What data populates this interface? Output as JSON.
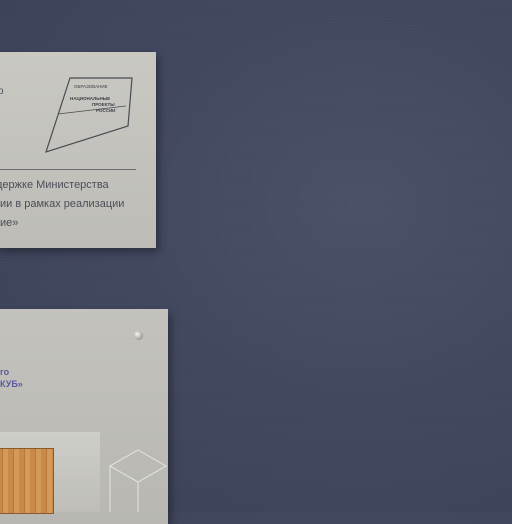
{
  "scene": "wall-with-plaques",
  "colors": {
    "wall": "#434960",
    "plaque": "#c4c3bd",
    "text": "#4c4e58",
    "accent_purple": "#5b5aa0",
    "wood": "#c98a49"
  },
  "plaque_top": {
    "edge_fragment": "о",
    "logo": {
      "line1": "ОБРАЗОВАНИЕ",
      "line2": "НАЦИОНАЛЬНЫЕ",
      "line3": "ПРОЕКТЫ",
      "line4": "РОССИИ"
    },
    "body_lines": [
      "держке Министерства",
      "ии в рамках реализации",
      "ие»"
    ]
  },
  "plaque_bottom": {
    "title_lines": [
      "го",
      "КУБ»"
    ]
  }
}
